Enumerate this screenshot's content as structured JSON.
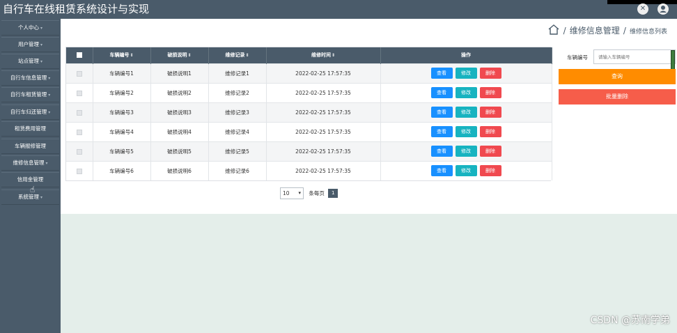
{
  "app": {
    "title": "自行车在线租赁系统设计与实现",
    "top_icons": [
      "close-x-icon",
      "user-icon"
    ]
  },
  "sidebar": {
    "items": [
      {
        "label": "个人中心",
        "has_caret": true
      },
      {
        "label": "用户管理",
        "has_caret": true
      },
      {
        "label": "站点管理",
        "has_caret": true
      },
      {
        "label": "自行车信息管理",
        "has_caret": true
      },
      {
        "label": "自行车租赁管理",
        "has_caret": true
      },
      {
        "label": "自行车归还管理",
        "has_caret": true
      },
      {
        "label": "租赁费用管理",
        "has_caret": false
      },
      {
        "label": "车辆报修管理",
        "has_caret": false
      },
      {
        "label": "维修信息管理",
        "has_caret": true
      },
      {
        "label": "信用金管理",
        "has_caret": false
      },
      {
        "label": "系统管理",
        "has_caret": true
      }
    ]
  },
  "breadcrumb": {
    "sep": "/",
    "main": "维修信息管理",
    "sub": "维修信息列表"
  },
  "table": {
    "columns": [
      "车辆编号",
      "破损说明",
      "维修记录",
      "维修时间",
      "操作"
    ],
    "sortable_marker": "⇕",
    "rows": [
      {
        "id": "车辆编号1",
        "damage": "破损说明1",
        "record": "维修记录1",
        "time": "2022-02-25 17:57:35"
      },
      {
        "id": "车辆编号2",
        "damage": "破损说明2",
        "record": "维修记录2",
        "time": "2022-02-25 17:57:35"
      },
      {
        "id": "车辆编号3",
        "damage": "破损说明3",
        "record": "维修记录3",
        "time": "2022-02-25 17:57:35"
      },
      {
        "id": "车辆编号4",
        "damage": "破损说明4",
        "record": "维修记录4",
        "time": "2022-02-25 17:57:35"
      },
      {
        "id": "车辆编号5",
        "damage": "破损说明5",
        "record": "维修记录5",
        "time": "2022-02-25 17:57:35"
      },
      {
        "id": "车辆编号6",
        "damage": "破损说明6",
        "record": "维修记录6",
        "time": "2022-02-25 17:57:35"
      }
    ],
    "actions": {
      "view": "查看",
      "edit": "修改",
      "delete": "删除"
    }
  },
  "pager": {
    "page_size": "10",
    "per_page_label": "条每页",
    "current_page": "1"
  },
  "search": {
    "label": "车辆编号",
    "placeholder": "请输入车辆编号",
    "query_button": "查询",
    "batch_delete_button": "批量删除"
  },
  "watermark": "CSDN @苏南学弟",
  "colors": {
    "header_bg": "#4a5b6a",
    "view": "#1890ff",
    "edit": "#17b3c0",
    "delete": "#f0494f",
    "query": "#ff8c00",
    "batch_delete": "#f65d4a",
    "lower_bg": "#e4eeea"
  }
}
